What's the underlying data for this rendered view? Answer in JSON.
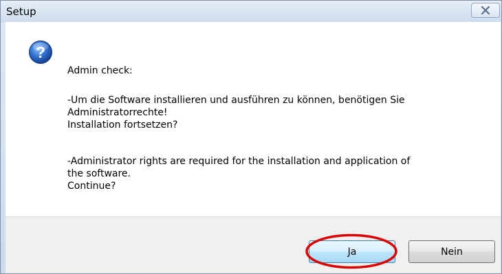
{
  "window": {
    "title": "Setup",
    "close_icon": "close-icon"
  },
  "dialog": {
    "icon": "question-icon",
    "heading": "Admin check:",
    "german_line1": "-Um die Software installieren und ausführen zu können, benötigen Sie",
    "german_line2": "Administratorrechte!",
    "german_line3": "Installation fortsetzen?",
    "english_line1": "-Administrator rights are required for the installation and application of",
    "english_line2": "the software.",
    "english_line3": "Continue?"
  },
  "buttons": {
    "yes_label": "Ja",
    "no_label": "Nein"
  },
  "colors": {
    "highlight_annotation": "#dd0000",
    "icon_blue": "#2a6bc2"
  }
}
